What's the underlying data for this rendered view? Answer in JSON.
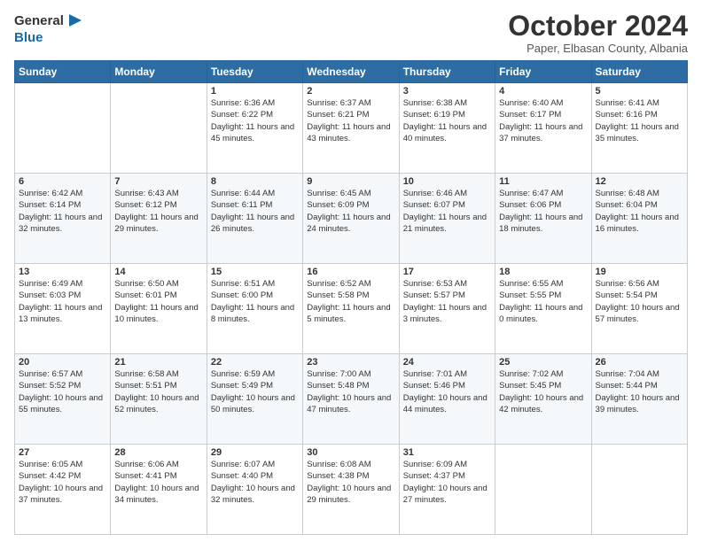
{
  "logo": {
    "general": "General",
    "blue": "Blue"
  },
  "title": "October 2024",
  "subtitle": "Paper, Elbasan County, Albania",
  "days": [
    "Sunday",
    "Monday",
    "Tuesday",
    "Wednesday",
    "Thursday",
    "Friday",
    "Saturday"
  ],
  "weeks": [
    [
      {
        "num": "",
        "sunrise": "",
        "sunset": "",
        "daylight": ""
      },
      {
        "num": "",
        "sunrise": "",
        "sunset": "",
        "daylight": ""
      },
      {
        "num": "1",
        "sunrise": "Sunrise: 6:36 AM",
        "sunset": "Sunset: 6:22 PM",
        "daylight": "Daylight: 11 hours and 45 minutes."
      },
      {
        "num": "2",
        "sunrise": "Sunrise: 6:37 AM",
        "sunset": "Sunset: 6:21 PM",
        "daylight": "Daylight: 11 hours and 43 minutes."
      },
      {
        "num": "3",
        "sunrise": "Sunrise: 6:38 AM",
        "sunset": "Sunset: 6:19 PM",
        "daylight": "Daylight: 11 hours and 40 minutes."
      },
      {
        "num": "4",
        "sunrise": "Sunrise: 6:40 AM",
        "sunset": "Sunset: 6:17 PM",
        "daylight": "Daylight: 11 hours and 37 minutes."
      },
      {
        "num": "5",
        "sunrise": "Sunrise: 6:41 AM",
        "sunset": "Sunset: 6:16 PM",
        "daylight": "Daylight: 11 hours and 35 minutes."
      }
    ],
    [
      {
        "num": "6",
        "sunrise": "Sunrise: 6:42 AM",
        "sunset": "Sunset: 6:14 PM",
        "daylight": "Daylight: 11 hours and 32 minutes."
      },
      {
        "num": "7",
        "sunrise": "Sunrise: 6:43 AM",
        "sunset": "Sunset: 6:12 PM",
        "daylight": "Daylight: 11 hours and 29 minutes."
      },
      {
        "num": "8",
        "sunrise": "Sunrise: 6:44 AM",
        "sunset": "Sunset: 6:11 PM",
        "daylight": "Daylight: 11 hours and 26 minutes."
      },
      {
        "num": "9",
        "sunrise": "Sunrise: 6:45 AM",
        "sunset": "Sunset: 6:09 PM",
        "daylight": "Daylight: 11 hours and 24 minutes."
      },
      {
        "num": "10",
        "sunrise": "Sunrise: 6:46 AM",
        "sunset": "Sunset: 6:07 PM",
        "daylight": "Daylight: 11 hours and 21 minutes."
      },
      {
        "num": "11",
        "sunrise": "Sunrise: 6:47 AM",
        "sunset": "Sunset: 6:06 PM",
        "daylight": "Daylight: 11 hours and 18 minutes."
      },
      {
        "num": "12",
        "sunrise": "Sunrise: 6:48 AM",
        "sunset": "Sunset: 6:04 PM",
        "daylight": "Daylight: 11 hours and 16 minutes."
      }
    ],
    [
      {
        "num": "13",
        "sunrise": "Sunrise: 6:49 AM",
        "sunset": "Sunset: 6:03 PM",
        "daylight": "Daylight: 11 hours and 13 minutes."
      },
      {
        "num": "14",
        "sunrise": "Sunrise: 6:50 AM",
        "sunset": "Sunset: 6:01 PM",
        "daylight": "Daylight: 11 hours and 10 minutes."
      },
      {
        "num": "15",
        "sunrise": "Sunrise: 6:51 AM",
        "sunset": "Sunset: 6:00 PM",
        "daylight": "Daylight: 11 hours and 8 minutes."
      },
      {
        "num": "16",
        "sunrise": "Sunrise: 6:52 AM",
        "sunset": "Sunset: 5:58 PM",
        "daylight": "Daylight: 11 hours and 5 minutes."
      },
      {
        "num": "17",
        "sunrise": "Sunrise: 6:53 AM",
        "sunset": "Sunset: 5:57 PM",
        "daylight": "Daylight: 11 hours and 3 minutes."
      },
      {
        "num": "18",
        "sunrise": "Sunrise: 6:55 AM",
        "sunset": "Sunset: 5:55 PM",
        "daylight": "Daylight: 11 hours and 0 minutes."
      },
      {
        "num": "19",
        "sunrise": "Sunrise: 6:56 AM",
        "sunset": "Sunset: 5:54 PM",
        "daylight": "Daylight: 10 hours and 57 minutes."
      }
    ],
    [
      {
        "num": "20",
        "sunrise": "Sunrise: 6:57 AM",
        "sunset": "Sunset: 5:52 PM",
        "daylight": "Daylight: 10 hours and 55 minutes."
      },
      {
        "num": "21",
        "sunrise": "Sunrise: 6:58 AM",
        "sunset": "Sunset: 5:51 PM",
        "daylight": "Daylight: 10 hours and 52 minutes."
      },
      {
        "num": "22",
        "sunrise": "Sunrise: 6:59 AM",
        "sunset": "Sunset: 5:49 PM",
        "daylight": "Daylight: 10 hours and 50 minutes."
      },
      {
        "num": "23",
        "sunrise": "Sunrise: 7:00 AM",
        "sunset": "Sunset: 5:48 PM",
        "daylight": "Daylight: 10 hours and 47 minutes."
      },
      {
        "num": "24",
        "sunrise": "Sunrise: 7:01 AM",
        "sunset": "Sunset: 5:46 PM",
        "daylight": "Daylight: 10 hours and 44 minutes."
      },
      {
        "num": "25",
        "sunrise": "Sunrise: 7:02 AM",
        "sunset": "Sunset: 5:45 PM",
        "daylight": "Daylight: 10 hours and 42 minutes."
      },
      {
        "num": "26",
        "sunrise": "Sunrise: 7:04 AM",
        "sunset": "Sunset: 5:44 PM",
        "daylight": "Daylight: 10 hours and 39 minutes."
      }
    ],
    [
      {
        "num": "27",
        "sunrise": "Sunrise: 6:05 AM",
        "sunset": "Sunset: 4:42 PM",
        "daylight": "Daylight: 10 hours and 37 minutes."
      },
      {
        "num": "28",
        "sunrise": "Sunrise: 6:06 AM",
        "sunset": "Sunset: 4:41 PM",
        "daylight": "Daylight: 10 hours and 34 minutes."
      },
      {
        "num": "29",
        "sunrise": "Sunrise: 6:07 AM",
        "sunset": "Sunset: 4:40 PM",
        "daylight": "Daylight: 10 hours and 32 minutes."
      },
      {
        "num": "30",
        "sunrise": "Sunrise: 6:08 AM",
        "sunset": "Sunset: 4:38 PM",
        "daylight": "Daylight: 10 hours and 29 minutes."
      },
      {
        "num": "31",
        "sunrise": "Sunrise: 6:09 AM",
        "sunset": "Sunset: 4:37 PM",
        "daylight": "Daylight: 10 hours and 27 minutes."
      },
      {
        "num": "",
        "sunrise": "",
        "sunset": "",
        "daylight": ""
      },
      {
        "num": "",
        "sunrise": "",
        "sunset": "",
        "daylight": ""
      }
    ]
  ]
}
